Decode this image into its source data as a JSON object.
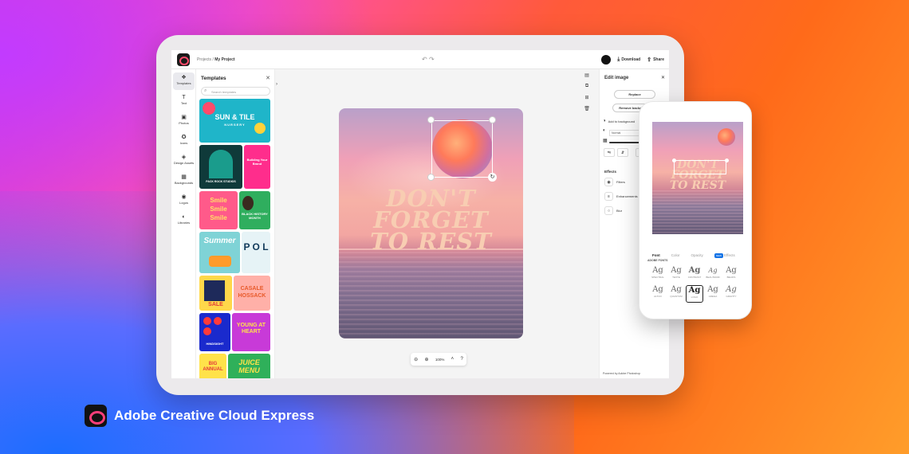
{
  "app": {
    "breadcrumb_root": "Projects",
    "breadcrumb_sep": "/",
    "project_name": "My Project",
    "download_label": "Download",
    "share_label": "Share"
  },
  "rail": {
    "items": [
      {
        "label": "Templates",
        "icon": "templates-icon"
      },
      {
        "label": "Text",
        "icon": "text-icon"
      },
      {
        "label": "Photos",
        "icon": "photos-icon"
      },
      {
        "label": "Icons",
        "icon": "icons-icon"
      },
      {
        "label": "Design Assets",
        "icon": "design-assets-icon"
      },
      {
        "label": "Backgrounds",
        "icon": "backgrounds-icon"
      },
      {
        "label": "Logos",
        "icon": "logos-icon"
      },
      {
        "label": "Libraries",
        "icon": "libraries-icon"
      }
    ]
  },
  "templates_panel": {
    "title": "Templates",
    "search_placeholder": "Search templates",
    "thumbs": {
      "sun_tile_title": "SUN & TILE",
      "sun_tile_sub": "NURSERY",
      "pack_rock": "PACK ROCK STUDIOS",
      "building": "Building Your Brand",
      "smile": "Smile Smile Smile",
      "black_history": "BLACK HISTORY MONTH",
      "summer": "Summer",
      "pol": "P O L",
      "sale": "SALE",
      "casale": "CASALE HOSSACK",
      "hindsight": "HINDSIGHT",
      "young_heart": "YOUNG AT HEART",
      "big_annual": "BIG ANNUAL",
      "juice_menu": "JUICE MENU"
    }
  },
  "canvas": {
    "headline": [
      "DON'T",
      "FORGET",
      "TO REST"
    ],
    "zoom_level": "100%"
  },
  "edit_panel": {
    "title": "Edit image",
    "replace_label": "Replace",
    "remove_bg_label": "Remove background",
    "add_bg_label": "Add to background",
    "blend_mode": "Normal",
    "effects_title": "Effects",
    "filters_label": "Filters",
    "enhancements_label": "Enhancements",
    "blur_label": "Blur",
    "powered_by": "Powered by Adobe Photoshop"
  },
  "phone": {
    "headline": [
      "DON'T",
      "FORGET",
      "TO REST"
    ],
    "tabs": [
      "Font",
      "Color",
      "Opacity",
      "Effects"
    ],
    "new_badge": "NEW",
    "section_label": "ADOBE FONTS",
    "font_glyph": "Ag",
    "fonts": [
      "SPECTRAL",
      "TEXTE",
      "CONTRAST",
      "BEAU BAND",
      "BELIDS",
      "ALTCO",
      "QUANTUM",
      "LOGO",
      "ADEGA",
      "GRAVITY"
    ]
  },
  "brand": {
    "name": "Adobe Creative Cloud Express"
  },
  "colors": {
    "accent": "#1473e6",
    "brand_red": "#ff3e7a",
    "headline": "#f8cdb2"
  }
}
